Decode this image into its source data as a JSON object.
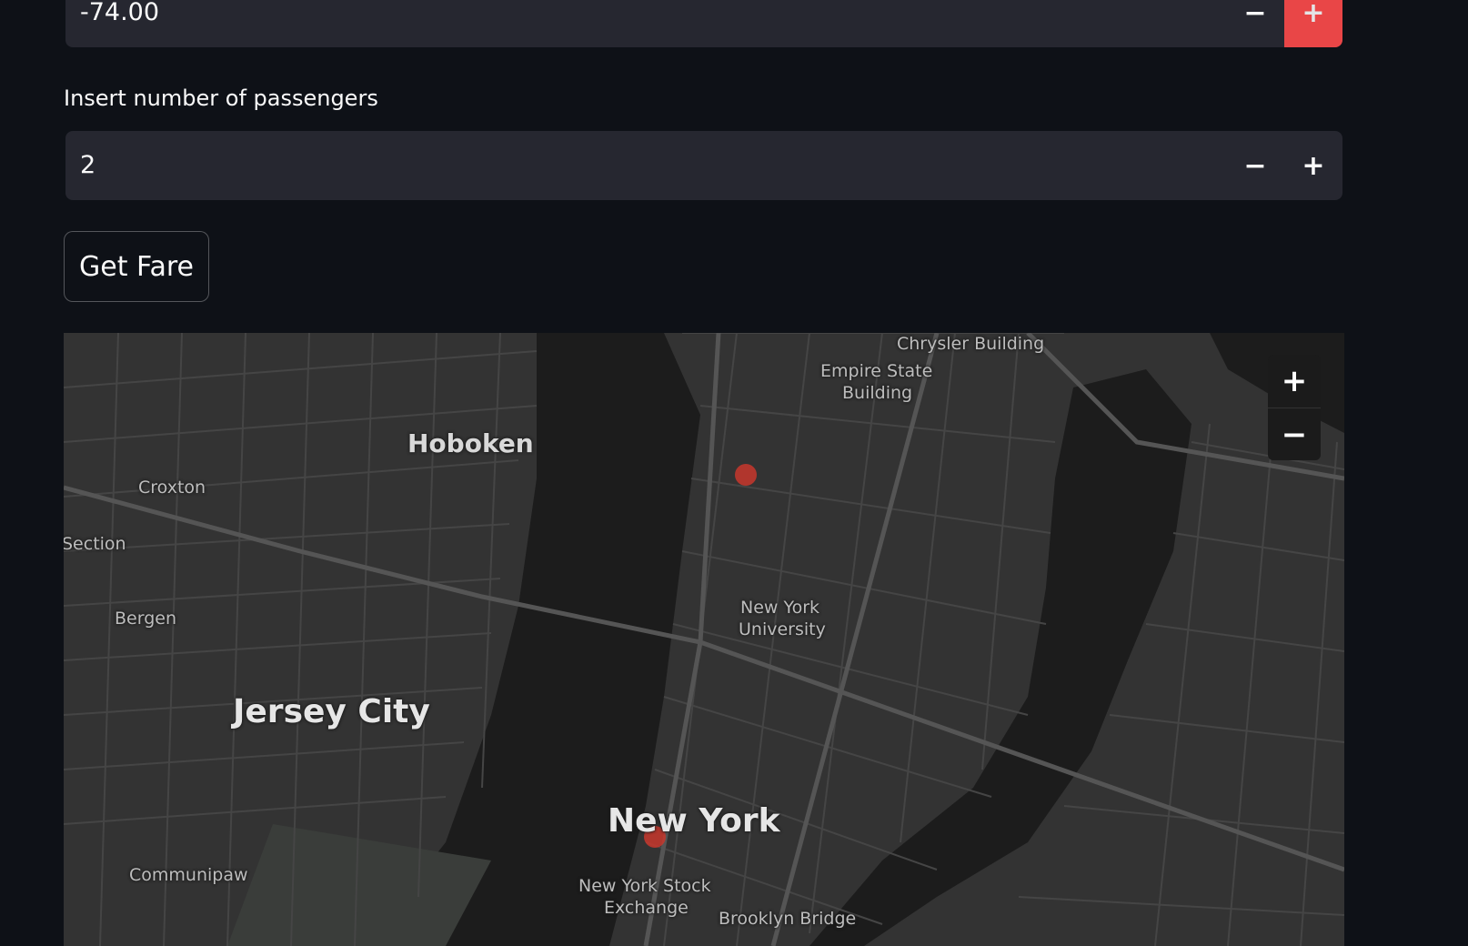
{
  "longitude_input": {
    "value": "-74.00",
    "minus": "−",
    "plus": "+"
  },
  "passengers": {
    "label": "Insert number of passengers",
    "value": "2",
    "minus": "−",
    "plus": "+"
  },
  "get_fare_button": "Get Fare",
  "map": {
    "zoom_in": "+",
    "zoom_out": "−",
    "labels": {
      "chrysler": "Chrysler Building",
      "empire_1": "Empire State",
      "empire_2": "Building",
      "hoboken": "Hoboken",
      "croxton": "Croxton",
      "section": "Section",
      "bergen": "Bergen",
      "nyu_1": "New York",
      "nyu_2": "University",
      "jersey_city": "Jersey City",
      "new_york": "New York",
      "nyse_1": "New York Stock",
      "nyse_2": "Exchange",
      "brooklyn_bridge": "Brooklyn Bridge",
      "communipaw": "Communipaw"
    }
  },
  "colors": {
    "accent": "#ff4b4b",
    "background": "#0e1117",
    "input": "#262730",
    "marker": "#c8372d"
  }
}
